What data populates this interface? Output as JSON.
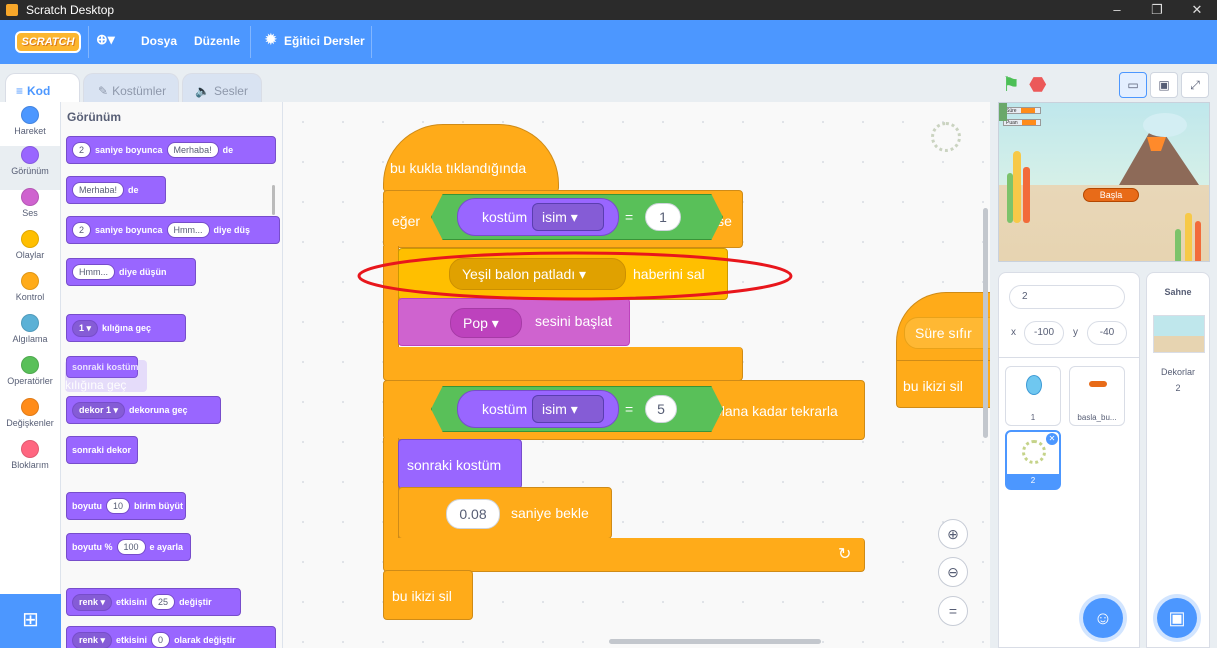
{
  "window": {
    "title": "Scratch Desktop",
    "minimize": "–",
    "maximize": "❐",
    "close": "✕"
  },
  "menubar": {
    "logo": "SCRATCH",
    "language_icon": "⊕▾",
    "file": "Dosya",
    "edit": "Düzenle",
    "tutorials": "Eğitici Dersler"
  },
  "tabs": [
    {
      "label": "Kod",
      "icon": "≡"
    },
    {
      "label": "Kostümler",
      "icon": "✎"
    },
    {
      "label": "Sesler",
      "icon": "🔈"
    }
  ],
  "categories": [
    {
      "label": "Hareket",
      "color": "#4c97ff"
    },
    {
      "label": "Görünüm",
      "color": "#9966ff"
    },
    {
      "label": "Ses",
      "color": "#cf63cf"
    },
    {
      "label": "Olaylar",
      "color": "#ffbf00"
    },
    {
      "label": "Kontrol",
      "color": "#ffab19"
    },
    {
      "label": "Algılama",
      "color": "#5cb1d6"
    },
    {
      "label": "Operatörler",
      "color": "#59c059"
    },
    {
      "label": "Değişkenler",
      "color": "#ff8c1a"
    },
    {
      "label": "Bloklarım",
      "color": "#ff6680"
    }
  ],
  "palette": {
    "heading": "Görünüm",
    "say_for_secs": {
      "secs": "2",
      "text1": "saniye boyunca",
      "msg": "Merhaba!",
      "text2": "de"
    },
    "say": {
      "msg": "Merhaba!",
      "text": "de"
    },
    "think_for_secs": {
      "secs": "2",
      "text1": "saniye boyunca",
      "msg": "Hmm...",
      "text2": "diye düş"
    },
    "think": {
      "msg": "Hmm...",
      "text": "diye düşün"
    },
    "switch_costume": {
      "value": "1 ▾",
      "text": "kılığına geç"
    },
    "next_costume": "sonraki kostüm",
    "ghost_text": "kılığına geç",
    "switch_backdrop": {
      "value": "dekor 1 ▾",
      "text": "dekoruna geç"
    },
    "next_backdrop": "sonraki dekor",
    "change_size": {
      "text1": "boyutu",
      "value": "10",
      "text2": "birim büyüt"
    },
    "set_size": {
      "text1": "boyutu %",
      "value": "100",
      "text2": "e ayarla"
    },
    "change_effect": {
      "dd": "renk ▾",
      "text1": "etkisini",
      "value": "25",
      "text2": "değiştir"
    },
    "set_effect": {
      "dd": "renk ▾",
      "text1": "etkisini",
      "value": "0",
      "text2": "olarak değiştir"
    }
  },
  "script": {
    "hat": "bu kukla tıklandığında",
    "if_label": "eğer",
    "then_label": "ise",
    "costume_reporter": "kostüm",
    "costume_dd": "isim ▾",
    "equals": "=",
    "if_value": "1",
    "broadcast_dd": "Yeşil balon patladı ▾",
    "broadcast_text": "haberini sal",
    "sound_dd": "Pop ▾",
    "sound_text": "sesini başlat",
    "repeat_value": "5",
    "repeat_text": "olana kadar tekrarla",
    "next_costume": "sonraki kostüm",
    "wait_value": "0.08",
    "wait_text": "saniye bekle",
    "delete_clone": "bu ikizi sil",
    "loop_arrow": "↻",
    "side_reset": "Süre sıfır",
    "side_delete": "bu ikizi sil",
    "zoom_in": "⊕",
    "zoom_out": "⊖",
    "zoom_reset": "="
  },
  "controls": {
    "green_flag": "⚑",
    "stop": "⬣"
  },
  "stage": {
    "var1_label": "Süre",
    "var2_label": "Puan",
    "start_button": "Başla"
  },
  "sprite_info": {
    "name": "2",
    "x_label": "x",
    "x_value": "-100",
    "y_label": "y",
    "y_value": "-40"
  },
  "sprites": [
    {
      "name": "1"
    },
    {
      "name": "basla_bu..."
    },
    {
      "name": "2"
    }
  ],
  "stage_pane": {
    "title": "Sahne",
    "backdrops_label": "Dekorlar",
    "backdrops_count": "2"
  },
  "colors": {
    "accent": "#4c97ff",
    "looks": "#9966ff",
    "control": "#ffab19",
    "operators": "#59c059",
    "sound": "#cf63cf",
    "annotation": "#e8161c"
  }
}
